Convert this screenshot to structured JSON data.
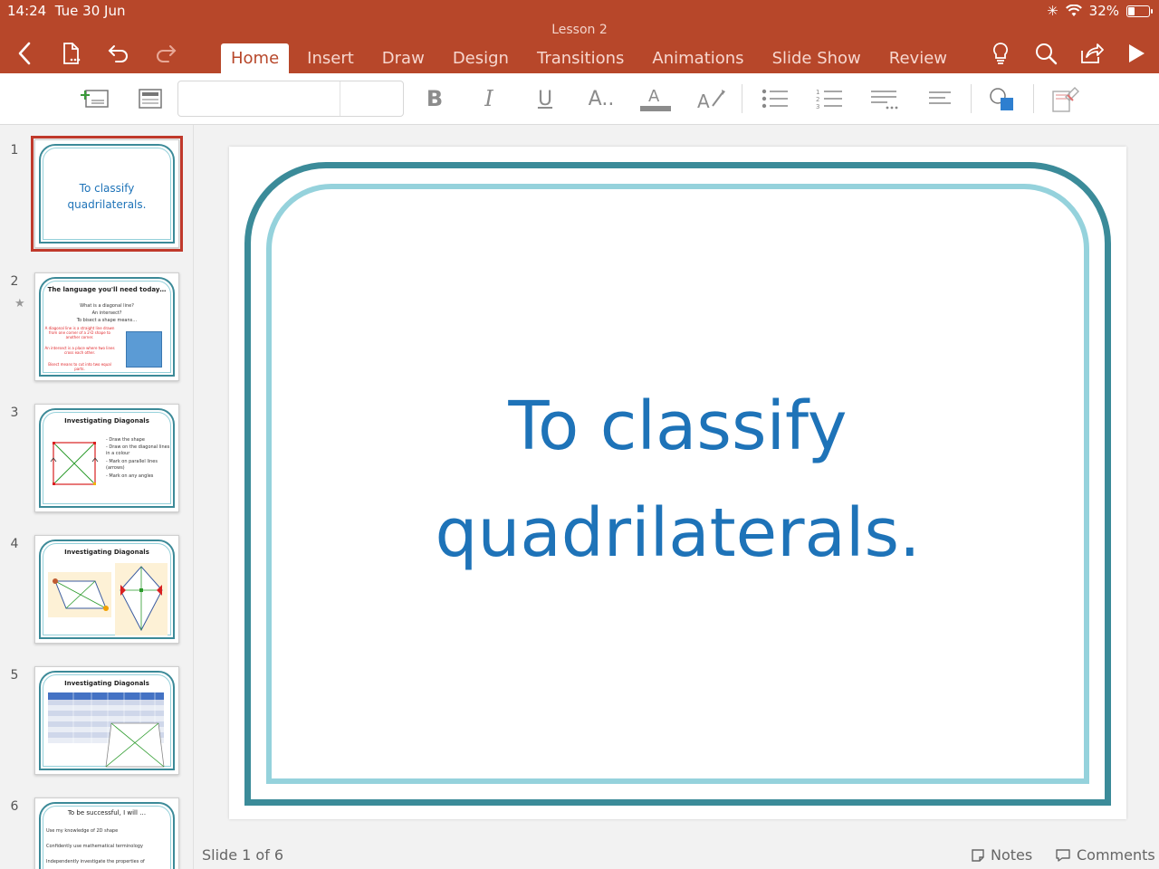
{
  "status": {
    "time": "14:24",
    "date": "Tue 30 Jun",
    "battery": "32%",
    "battery_level": 0.32
  },
  "document": {
    "title": "Lesson 2"
  },
  "tabs": [
    "Home",
    "Insert",
    "Draw",
    "Design",
    "Transitions",
    "Animations",
    "Slide Show",
    "Review"
  ],
  "active_tab": "Home",
  "thumbnails": {
    "nums": [
      "1",
      "2",
      "3",
      "4",
      "5",
      "6"
    ],
    "slide1": {
      "title": "To classify quadrilaterals."
    },
    "slide2": {
      "title": "The language you'll need today…",
      "lines": [
        "What is a diagonal line?",
        "An intersect?",
        "To bisect a shape means…"
      ],
      "red_lines": [
        "A diagonal line is a straight line drawn from one corner of a 2-D shape to another corner.",
        "An intersect is a place where two lines cross each other.",
        "Bisect means to cut into two equal parts."
      ]
    },
    "slide3": {
      "title": "Investigating Diagonals",
      "bullets": [
        "- Draw the shape",
        "- Draw on the diagonal lines in a colour",
        "- Mark on parallel lines (arrows)",
        "- Mark on any angles"
      ]
    },
    "slide4": {
      "title": "Investigating Diagonals"
    },
    "slide5": {
      "title": "Investigating Diagonals"
    },
    "slide6": {
      "title": "To be successful, I will …",
      "lines": [
        "Use my knowledge of 2D shape",
        "Confidently use mathematical terminology",
        "Independently investigate the properties of"
      ]
    }
  },
  "slide": {
    "title_line1": "To classify",
    "title_line2": "quadrilaterals."
  },
  "footer": {
    "slide_count": "Slide 1 of 6",
    "notes": "Notes",
    "comments": "Comments"
  },
  "colors": {
    "accent": "#b7472a",
    "frame_dark": "#3b8b99",
    "frame_light": "#95d2dc",
    "title_blue": "#1e73b8"
  }
}
